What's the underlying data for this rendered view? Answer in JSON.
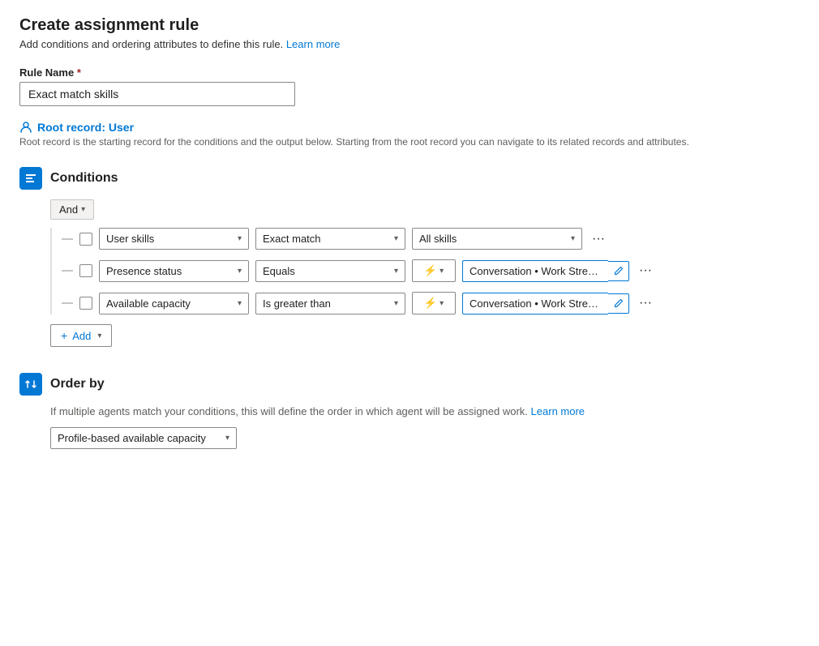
{
  "page": {
    "title": "Create assignment rule",
    "subtitle": "Add conditions and ordering attributes to define this rule.",
    "learn_more_label": "Learn more"
  },
  "rule_name": {
    "label": "Rule Name",
    "required": true,
    "value": "Exact match skills"
  },
  "root_record": {
    "icon": "👤",
    "label": "Root record: User",
    "description": "Root record is the starting record for the conditions and the output below. Starting from the root record you can navigate to its related records and attributes."
  },
  "conditions_section": {
    "title": "Conditions",
    "and_label": "And",
    "rows": [
      {
        "field": "User skills",
        "operator": "Exact match",
        "value_type": "simple",
        "value": "All skills"
      },
      {
        "field": "Presence status",
        "operator": "Equals",
        "value_type": "dynamic",
        "value": "Conversation • Work Stream • All..."
      },
      {
        "field": "Available capacity",
        "operator": "Is greater than",
        "value_type": "dynamic",
        "value": "Conversation • Work Stream • Ca..."
      }
    ],
    "add_label": "Add"
  },
  "order_section": {
    "title": "Order by",
    "description": "If multiple agents match your conditions, this will define the order in which agent will be assigned work.",
    "learn_more_label": "Learn more",
    "dropdown_value": "Profile-based available capacity"
  }
}
